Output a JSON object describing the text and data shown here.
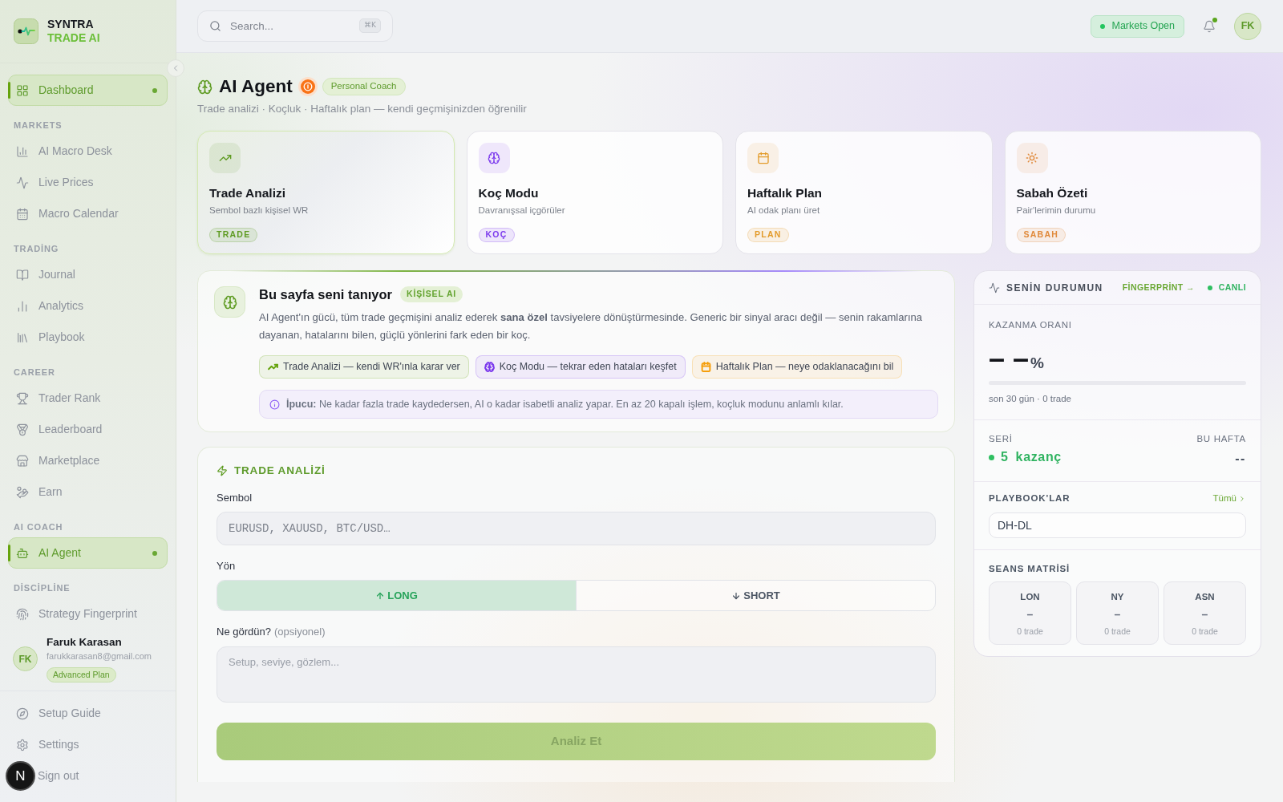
{
  "sidebar": {
    "brand": {
      "name": "SYNTRA",
      "tagline": "TRADE AI"
    },
    "sections": [
      {
        "items": [
          {
            "label": "Dashboard",
            "selected": true
          }
        ]
      },
      {
        "title": "MARKETS",
        "items": [
          {
            "label": "AI Macro Desk",
            "selected": false
          },
          {
            "label": "Live Prices",
            "selected": false
          },
          {
            "label": "Macro Calendar",
            "selected": false
          }
        ]
      },
      {
        "title": "TRADİNG",
        "items": [
          {
            "label": "Journal",
            "selected": false
          },
          {
            "label": "Analytics",
            "selected": false
          },
          {
            "label": "Playbook",
            "selected": false
          }
        ]
      },
      {
        "title": "CAREER",
        "items": [
          {
            "label": "Trader Rank",
            "selected": false
          },
          {
            "label": "Leaderboard",
            "selected": false
          },
          {
            "label": "Marketplace",
            "selected": false
          },
          {
            "label": "Earn",
            "selected": false
          }
        ]
      },
      {
        "title": "AI COACH",
        "items": [
          {
            "label": "AI Agent",
            "selected": true
          }
        ]
      },
      {
        "title": "DİSCİPLİNE",
        "items": [
          {
            "label": "Strategy Fingerprint",
            "selected": false
          }
        ]
      }
    ],
    "user": {
      "initials": "FK",
      "name": "Faruk Karasan",
      "email": "farukkarasan8@gmail.com",
      "plan": "Advanced Plan"
    },
    "footer_items": [
      {
        "label": "Setup Guide"
      },
      {
        "label": "Settings"
      },
      {
        "label": "Sign out"
      }
    ]
  },
  "dev_tools_button": {
    "label": "N"
  },
  "header": {
    "search": {
      "placeholder": "Search...",
      "shortcut": "⌘K"
    },
    "market_status": "Markets Open",
    "notifications": {
      "unread": true
    },
    "avatar": "FK"
  },
  "page": {
    "title": "AI Agent",
    "badge": "Personal Coach",
    "subtitle": "Trade analizi · Koçluk · Haftalık plan — kendi geçmişinizden öğrenilir"
  },
  "feature_cards": [
    {
      "title": "Trade Analizi",
      "subtitle": "Sembol bazlı kişisel WR",
      "tag": "TRADE",
      "color": "#5e9b22",
      "selected": true
    },
    {
      "title": "Koç Modu",
      "subtitle": "Davranışsal içgörüler",
      "tag": "KOÇ",
      "color": "#7c3aed",
      "selected": false
    },
    {
      "title": "Haftalık Plan",
      "subtitle": "AI odak planı üret",
      "tag": "PLAN",
      "color": "#e39b2a",
      "selected": false
    },
    {
      "title": "Sabah Özeti",
      "subtitle": "Pair'lerimin durumu",
      "tag": "SABAH",
      "color": "#e0893a",
      "selected": false
    }
  ],
  "intro": {
    "title": "Bu sayfa seni tanıyor",
    "badge": "KİŞİSEL AI",
    "text": "AI Agent'ın gücü, tüm trade geçmişini analiz ederek **sana özel** tavsiyelere dönüştürmesinde. Generic bir sinyal aracı değil — senin rakamlarına dayanan, hatalarını bilen, güçlü yönlerini fark eden bir koç.",
    "chips": [
      {
        "label": "Trade Analizi — kendi WR'ınla karar ver",
        "color": "#65a30d"
      },
      {
        "label": "Koç Modu — tekrar eden hataları keşfet",
        "color": "#7c3aed"
      },
      {
        "label": "Haftalık Plan — neye odaklanacağını bil",
        "color": "#f59e0b"
      }
    ],
    "tip": "**İpucu:** Ne kadar fazla trade kaydedersen, AI o kadar isabetli analiz yapar. En az 20 kapalı işlem, koçluk modunu anlamlı kılar."
  },
  "trade_analysis": {
    "title": "TRADE ANALİZİ",
    "symbol": {
      "label": "Sembol",
      "placeholder": "EURUSD, XAUUSD, BTC/USD…"
    },
    "direction": {
      "label": "Yön",
      "options": [
        {
          "label": "LONG",
          "selected": true
        },
        {
          "label": "SHORT",
          "selected": false
        }
      ]
    },
    "notes": {
      "label": "Ne gördün?",
      "hint": "(opsiyonel)",
      "placeholder": "Setup, seviye, gözlem..."
    },
    "submit": {
      "label": "Analiz Et",
      "disabled": true
    }
  },
  "status_panel": {
    "title": "SENİN DURUMUN",
    "link": "FİNGERPRİNT →",
    "live": "CANLI",
    "win_rate": {
      "label": "KAZANMA ORANI",
      "value": "– –",
      "unit": "%",
      "caption": "son 30 gün · 0 trade"
    },
    "streak": {
      "label": "SERİ",
      "value": "5 kazanç"
    },
    "this_week": {
      "label": "BU HAFTA",
      "value": "--"
    },
    "playbooks": {
      "title": "PLAYBOOK'LAR",
      "link": "Tümü",
      "items": [
        "DH-DL"
      ]
    },
    "sessions": {
      "title": "SEANS MATRİSİ",
      "cells": [
        {
          "name": "LON",
          "value": "–",
          "trades": "0 trade"
        },
        {
          "name": "NY",
          "value": "–",
          "trades": "0 trade"
        },
        {
          "name": "ASN",
          "value": "–",
          "trades": "0 trade"
        }
      ]
    }
  }
}
